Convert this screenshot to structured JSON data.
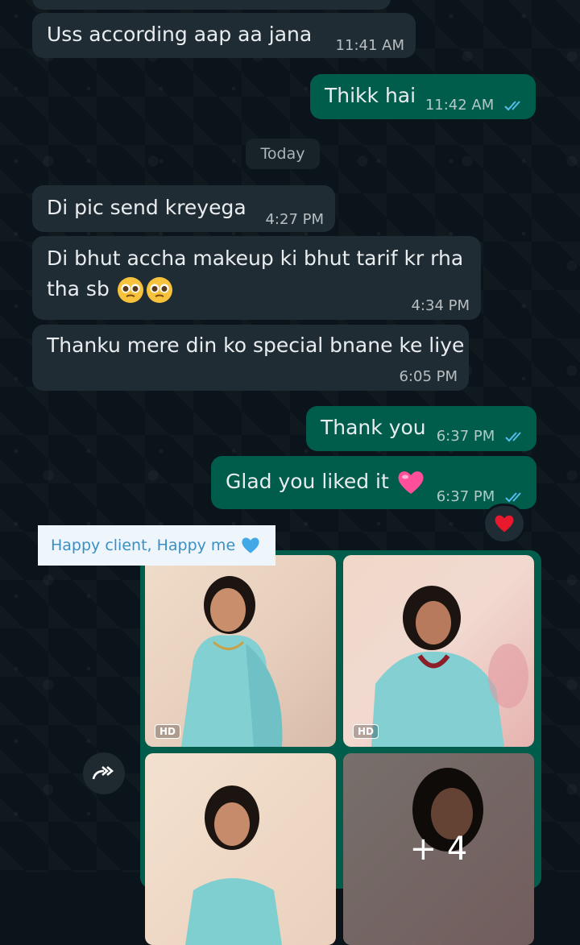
{
  "date_divider": "Today",
  "messages": [
    {
      "text": "Uss according aap aa jana",
      "time": "11:41 AM"
    },
    {
      "text": "Thikk hai",
      "time": "11:42 AM"
    },
    {
      "text": "Di pic send kreyega",
      "time": "4:27 PM"
    },
    {
      "text_line1": "Di bhut accha makeup ki bhut tarif kr rha",
      "text_line2": "tha sb",
      "time": "4:34 PM"
    },
    {
      "text": "Thanku mere din ko special bnane ke liye",
      "time": "6:05 PM"
    },
    {
      "text": "Thank you",
      "time": "6:37 PM"
    },
    {
      "text": "Glad you liked it",
      "time": "6:37 PM"
    }
  ],
  "caption": "Happy client, Happy me",
  "album": {
    "hd_label": "HD",
    "more_count": "+ 4"
  },
  "colors": {
    "background": "#0b141a",
    "incoming": "#202c33",
    "outgoing": "#005c4b",
    "read_ticks": "#53bdeb"
  },
  "icons": {
    "read": "double-check-icon",
    "reaction": "red-heart-icon",
    "forward": "forward-icon"
  }
}
